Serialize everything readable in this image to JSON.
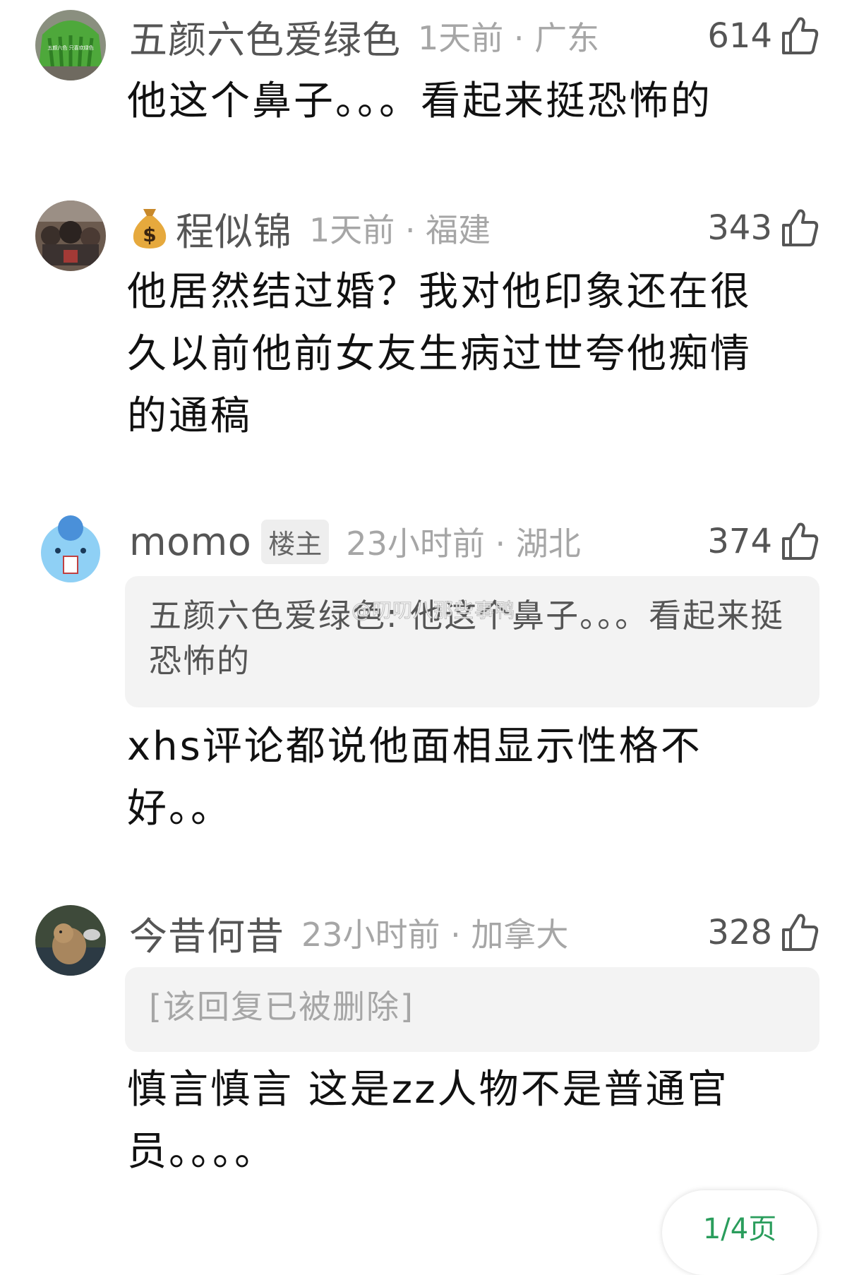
{
  "comments": [
    {
      "username": "五颜六色爱绿色",
      "avatar_label": "五颜六色 只喜欢绿色",
      "time_location": "1天前 · 广东",
      "likes": "614",
      "text": "他这个鼻子。。。看起来挺恐怖的"
    },
    {
      "username": "程似锦",
      "badge_icon": "money-bag-icon",
      "time_location": "1天前 · 福建",
      "likes": "343",
      "text": "他居然结过婚？我对他印象还在很久以前他前女友生病过世夸他痴情的通稿"
    },
    {
      "username": "momo",
      "op_tag": "楼主",
      "time_location": "23小时前 · 湖北",
      "likes": "374",
      "quote": "五颜六色爱绿色: 他这个鼻子。。。看起来挺恐怖的",
      "text": "xhs评论都说他面相显示性格不好。。"
    },
    {
      "username": "今昔何昔",
      "time_location": "23小时前 · 加拿大",
      "likes": "328",
      "quote": "[该回复已被删除]",
      "text": "慎言慎言 这是zz人物不是普通官员。。。。"
    }
  ],
  "watermark": "@叨叨八那些事鸭",
  "pager": {
    "label": "1/4页"
  },
  "colors": {
    "username": "#555555",
    "meta": "#a6a6a6",
    "quote_bg": "#f3f3f3",
    "pager_accent": "#2a9d5c"
  }
}
